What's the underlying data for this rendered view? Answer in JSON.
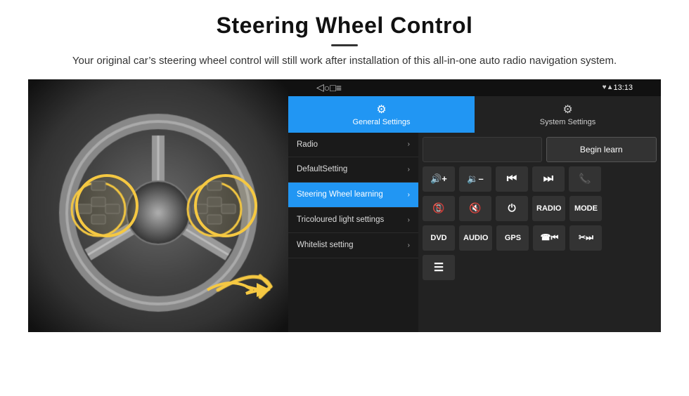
{
  "header": {
    "title": "Steering Wheel Control",
    "subtitle": "Your original car’s steering wheel control will still work after installation of this all-in-one auto radio navigation system."
  },
  "android_ui": {
    "status_bar": {
      "back": "◁",
      "home": "○",
      "recent": "□",
      "screenshot": "≡",
      "signal_icon": "♥",
      "wifi_icon": "▲",
      "time": "13:13",
      "location_icon": "•"
    },
    "tabs": [
      {
        "id": "general",
        "label": "General Settings",
        "icon": "⚙",
        "active": true
      },
      {
        "id": "system",
        "label": "System Settings",
        "icon": "⛋",
        "active": false
      }
    ],
    "menu": [
      {
        "id": "radio",
        "label": "Radio",
        "active": false
      },
      {
        "id": "default",
        "label": "DefaultSetting",
        "active": false
      },
      {
        "id": "steering",
        "label": "Steering Wheel learning",
        "active": true
      },
      {
        "id": "tricoloured",
        "label": "Tricoloured light settings",
        "active": false
      },
      {
        "id": "whitelist",
        "label": "Whitelist setting",
        "active": false
      }
    ],
    "buttons_top_row": {
      "empty_label": "",
      "begin_learn": "Begin learn"
    },
    "buttons_row2": [
      {
        "label": "◄+ ",
        "id": "vol-up",
        "symbol": "vol-plus"
      },
      {
        "label": "◄–",
        "id": "vol-down",
        "symbol": "vol-minus"
      },
      {
        "label": "⏮",
        "id": "prev"
      },
      {
        "label": "⏭",
        "id": "next"
      },
      {
        "label": "☎",
        "id": "phone"
      }
    ],
    "buttons_row3": [
      {
        "label": "✆",
        "id": "hangup"
      },
      {
        "label": "🔇",
        "id": "mute"
      },
      {
        "label": "⏻",
        "id": "power"
      },
      {
        "label": "RADIO",
        "id": "radio-btn"
      },
      {
        "label": "MODE",
        "id": "mode"
      }
    ],
    "buttons_row4": [
      {
        "label": "DVD",
        "id": "dvd"
      },
      {
        "label": "AUDIO",
        "id": "audio"
      },
      {
        "label": "GPS",
        "id": "gps"
      },
      {
        "label": "☎⏮",
        "id": "phone-prev"
      },
      {
        "label": "✂⏭",
        "id": "phone-next"
      }
    ],
    "buttons_row5": [
      {
        "label": "☰",
        "id": "menu-icon"
      }
    ]
  }
}
